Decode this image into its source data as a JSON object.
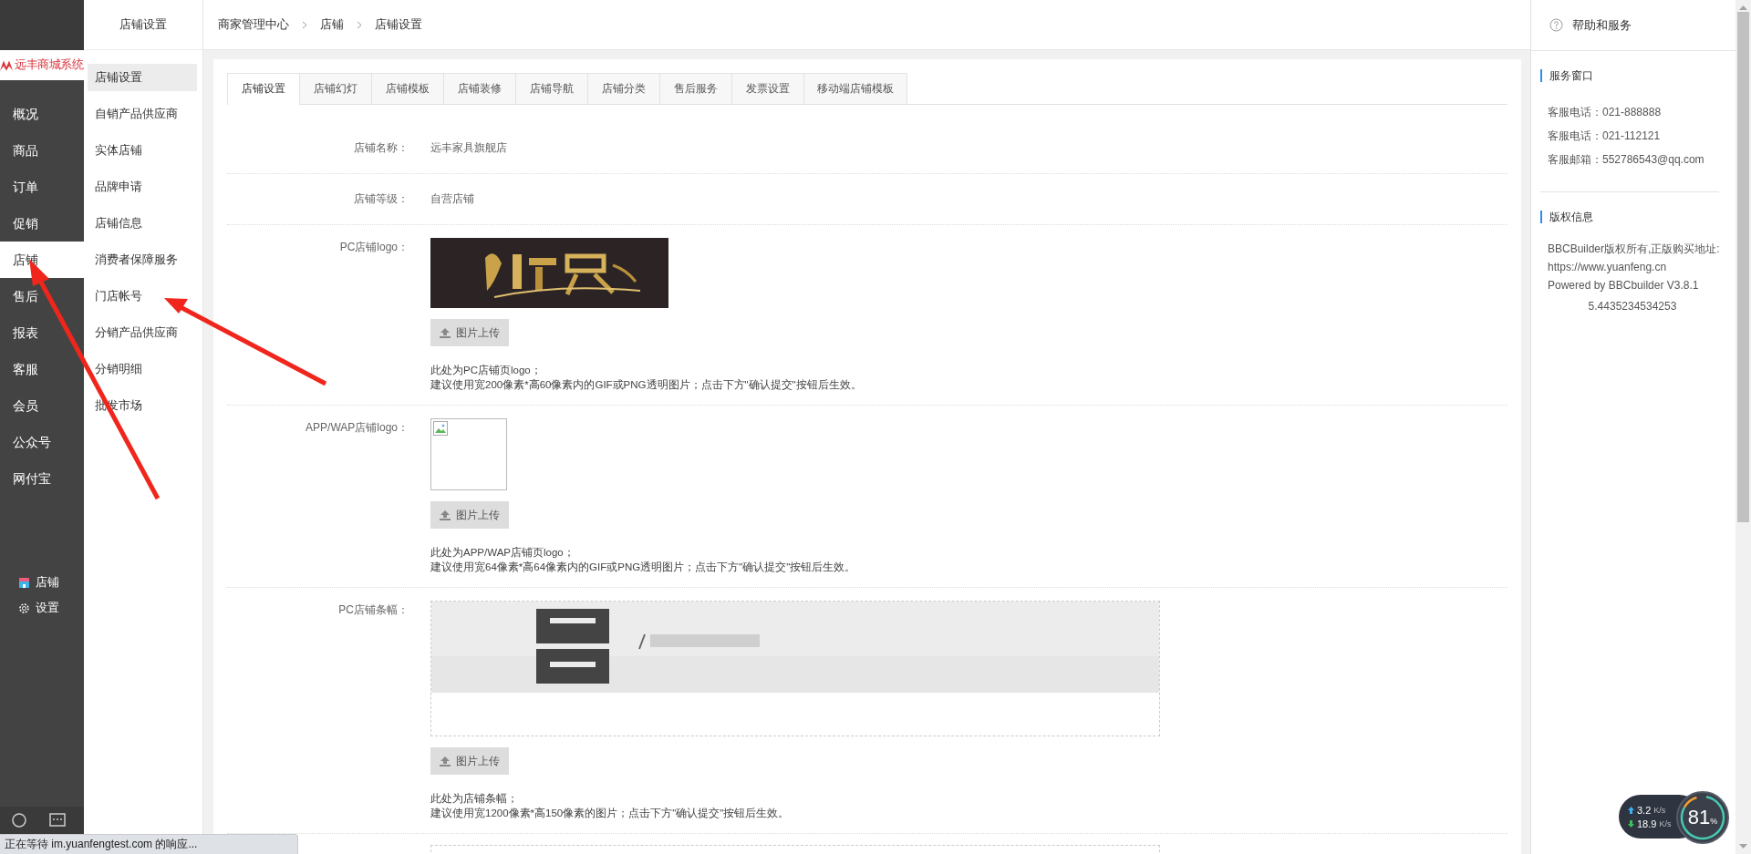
{
  "sidebar": {
    "logo": "远丰商城系统",
    "menu": [
      {
        "label": "概况",
        "selected": false
      },
      {
        "label": "商品",
        "selected": false
      },
      {
        "label": "订单",
        "selected": false
      },
      {
        "label": "促销",
        "selected": false
      },
      {
        "label": "店铺",
        "selected": true
      },
      {
        "label": "售后",
        "selected": false
      },
      {
        "label": "报表",
        "selected": false
      },
      {
        "label": "客服",
        "selected": false
      },
      {
        "label": "会员",
        "selected": false
      },
      {
        "label": "公众号",
        "selected": false
      },
      {
        "label": "网付宝",
        "selected": false
      }
    ],
    "shortcuts": [
      {
        "kind": "shop",
        "label": "店铺"
      },
      {
        "kind": "settings",
        "label": "设置"
      }
    ]
  },
  "sub_nav": {
    "title": "店铺设置",
    "items": [
      {
        "label": "店铺设置",
        "selected": true
      },
      {
        "label": "自销产品供应商",
        "selected": false
      },
      {
        "label": "实体店铺",
        "selected": false
      },
      {
        "label": "品牌申请",
        "selected": false
      },
      {
        "label": "店铺信息",
        "selected": false
      },
      {
        "label": "消费者保障服务",
        "selected": false
      },
      {
        "label": "门店帐号",
        "selected": false
      },
      {
        "label": "分销产品供应商",
        "selected": false
      },
      {
        "label": "分销明细",
        "selected": false
      },
      {
        "label": "批发市场",
        "selected": false
      }
    ]
  },
  "breadcrumb": [
    "商家管理中心",
    "店铺",
    "店铺设置"
  ],
  "tabs": [
    {
      "label": "店铺设置",
      "selected": true
    },
    {
      "label": "店铺幻灯",
      "selected": false
    },
    {
      "label": "店铺模板",
      "selected": false
    },
    {
      "label": "店铺装修",
      "selected": false
    },
    {
      "label": "店铺导航",
      "selected": false
    },
    {
      "label": "店铺分类",
      "selected": false
    },
    {
      "label": "售后服务",
      "selected": false
    },
    {
      "label": "发票设置",
      "selected": false
    },
    {
      "label": "移动端店铺模板",
      "selected": false
    }
  ],
  "form": {
    "rows": [
      {
        "kind": "text",
        "label": "店铺名称：",
        "value": "远丰家具旗舰店"
      },
      {
        "kind": "text",
        "label": "店铺等级：",
        "value": "自营店铺"
      },
      {
        "kind": "logo",
        "label": "PC店铺logo：",
        "button": "图片上传",
        "notes": [
          "此处为PC店铺页logo；",
          "建议使用宽200像素*高60像素内的GIF或PNG透明图片；点击下方\"确认提交\"按钮后生效。"
        ]
      },
      {
        "kind": "broken",
        "label": "APP/WAP店铺logo：",
        "button": "图片上传",
        "notes": [
          "此处为APP/WAP店铺页logo；",
          "建议使用宽64像素*高64像素内的GIF或PNG透明图片；点击下方\"确认提交\"按钮后生效。"
        ]
      },
      {
        "kind": "banner",
        "label": "PC店铺条幅：",
        "button": "图片上传",
        "notes": [
          "此处为店铺条幅；",
          "建议使用宽1200像素*高150像素的图片；点击下方\"确认提交\"按钮后生效。"
        ]
      },
      {
        "kind": "frame"
      }
    ]
  },
  "help_panel": {
    "title": "帮助和服务",
    "sections": [
      {
        "title": "服务窗口",
        "lines": [
          "客服电话：021-888888",
          "客服电话：021-112121",
          "客服邮箱：552786543@qq.com"
        ]
      },
      {
        "title": "版权信息",
        "lines": [
          "BBCBuilder版权所有,正版购买地址:",
          "https://www.yuanfeng.cn",
          "Powered by BBCbuilder V3.8.1"
        ],
        "footer": "5.4435234534253"
      }
    ]
  },
  "net_widget": {
    "upload": "3.2",
    "upload_unit": "K/s",
    "download": "18.9",
    "download_unit": "K/s",
    "usage": "81",
    "usage_unit": "%"
  },
  "status_bar": "正在等待 im.yuanfengtest.com 的响应..."
}
